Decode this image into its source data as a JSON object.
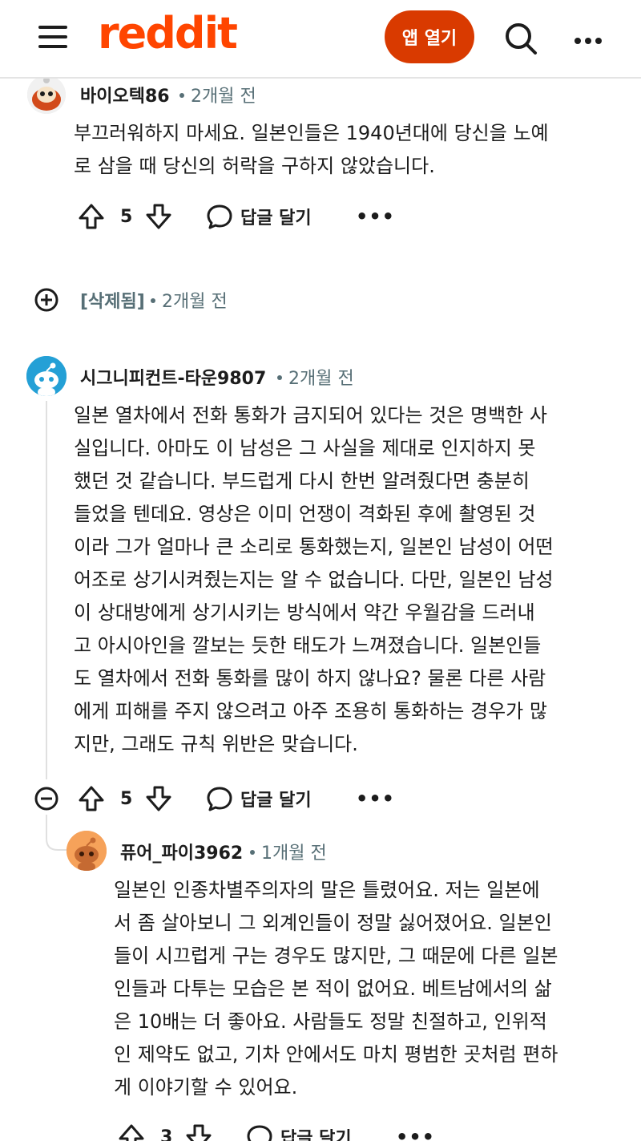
{
  "header": {
    "logo": "reddit",
    "app_button": "앱 열기"
  },
  "comments": [
    {
      "username": "바이오텍86",
      "time": "2개월 전",
      "lines": [
        "부끄러워하지 마세요. 일본인들은 1940년대에 당신을 노예",
        "로 삼을 때 당신의 허락을 구하지 않았습니다."
      ],
      "votes": "5",
      "reply_label": "답글 달기"
    },
    {
      "username": "[삭제됨]",
      "time": "2개월 전"
    },
    {
      "username": "시그니피컨트-타운9807",
      "time": "2개월 전",
      "lines": [
        "일본 열차에서 전화 통화가 금지되어 있다는 것은 명백한 사",
        "실입니다. 아마도 이 남성은 그 사실을 제대로 인지하지 못",
        "했던 것 같습니다. 부드럽게 다시 한번 알려줬다면 충분히",
        "들었을 텐데요. 영상은 이미 언쟁이 격화된 후에 촬영된 것",
        "이라 그가 얼마나 큰 소리로 통화했는지, 일본인 남성이 어떤",
        "어조로 상기시켜줬는지는 알 수 없습니다. 다만, 일본인 남성",
        "이 상대방에게 상기시키는 방식에서 약간 우월감을 드러내",
        "고 아시아인을 깔보는 듯한 태도가 느껴졌습니다. 일본인들",
        "도 열차에서 전화 통화를 많이 하지 않나요? 물론 다른 사람",
        "에게 피해를 주지 않으려고 아주 조용히 통화하는 경우가 많",
        "지만, 그래도 규칙 위반은 맞습니다."
      ],
      "votes": "5",
      "reply_label": "답글 달기"
    },
    {
      "username": "퓨어_파이3962",
      "time": "1개월 전",
      "lines": [
        "일본인 인종차별주의자의 말은 틀렸어요. 저는 일본에",
        "서 좀 살아보니 그 외계인들이 정말 싫어졌어요. 일본인",
        "들이 시끄럽게 구는 경우도 많지만, 그 때문에 다른 일본",
        "인들과 다투는 모습은 본 적이 없어요. 베트남에서의 삶",
        "은 10배는 더 좋아요. 사람들도 정말 친절하고, 인위적",
        "인 제약도 없고, 기차 안에서도 마치 평범한 곳처럼 편하",
        "게 이야기할 수 있어요."
      ],
      "votes": "3",
      "reply_label": "답글 달기"
    }
  ],
  "colors": {
    "brand": "#ff4500",
    "app_button": "#d93a00",
    "meta_text": "#576f76",
    "snoo_blue": "#24a0d6",
    "snoo_orange": "#f6a25a"
  }
}
